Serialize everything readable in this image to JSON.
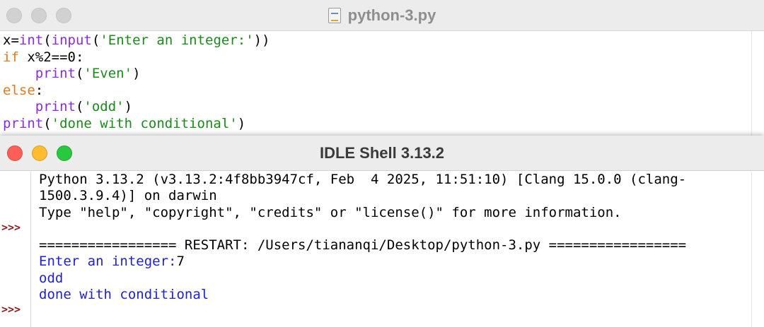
{
  "editor": {
    "title": "python-3.py",
    "code": {
      "l1_var": "x=",
      "l1_int": "int",
      "l1_p1": "(",
      "l1_input": "input",
      "l1_p2": "(",
      "l1_str": "'Enter an integer:'",
      "l1_p3": "))",
      "l2_if": "if",
      "l2_rest": " x%2==0:",
      "l3_indent": "    ",
      "l3_print": "print",
      "l3_p1": "(",
      "l3_str": "'Even'",
      "l3_p2": ")",
      "l4_else": "else",
      "l4_colon": ":",
      "l5_indent": "    ",
      "l5_print": "print",
      "l5_p1": "(",
      "l5_str": "'odd'",
      "l5_p2": ")",
      "l6_print": "print",
      "l6_p1": "(",
      "l6_str": "'done with conditional'",
      "l6_p2": ")"
    }
  },
  "shell": {
    "title": "IDLE Shell 3.13.2",
    "prompt": ">>>",
    "banner_line1": "Python 3.13.2 (v3.13.2:4f8bb3947cf, Feb  4 2025, 11:51:10) [Clang 15.0.0 (clang-",
    "banner_line2": "1500.3.9.4)] on darwin",
    "banner_line3": "Type \"help\", \"copyright\", \"credits\" or \"license()\" for more information.",
    "restart_line": "================= RESTART: /Users/tiananqi/Desktop/python-3.py =================",
    "input_prompt": "Enter an integer:",
    "input_value": "7",
    "output_odd": "odd",
    "output_done": "done with conditional"
  },
  "colors": {
    "keyword": "#e07b1f",
    "builtin": "#8a2be2",
    "string": "#1a8a1a",
    "stdout": "#1f1fd6",
    "prompt": "#8b1a1a"
  }
}
